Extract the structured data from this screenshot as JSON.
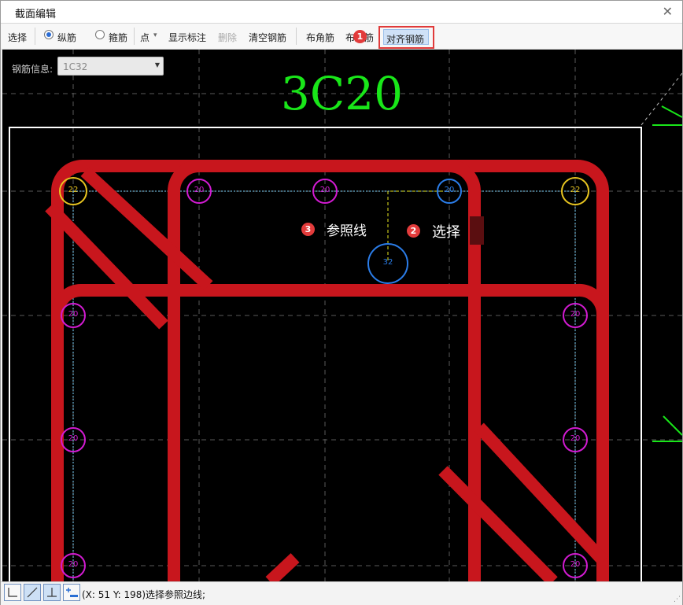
{
  "window": {
    "title": "截面编辑",
    "close_glyph": "✕"
  },
  "toolbar": {
    "select": "选择",
    "longitudinal": "纵筋",
    "stirrup": "箍筋",
    "point": "点",
    "point_arrow": "▾",
    "show_label": "显示标注",
    "delete": "删除",
    "clear_bars": "清空钢筋",
    "corner_bars": "布角筋",
    "edge_bars": "布边筋",
    "align_bars": "对齐钢筋"
  },
  "badges": {
    "b1": "1",
    "b2": "2",
    "b3": "3"
  },
  "canvas": {
    "rebar_info_label": "钢筋信息:",
    "rebar_info_value": "1C32",
    "top_label": "3C20",
    "callout_reference_line": "参照线",
    "callout_select": "选择",
    "bars": {
      "corner_tl": "22",
      "top_1": "20",
      "top_2": "20",
      "top_3": "20",
      "corner_tr": "22",
      "selected": "32",
      "left_1": "20",
      "left_2": "20",
      "left_3": "20",
      "right_1": "20",
      "right_2": "20",
      "right_3": "20"
    }
  },
  "statusbar": {
    "text": "(X: 51 Y: 198)选择参照边线;",
    "grip": "⋰"
  },
  "colors": {
    "stirrup_red": "#c8161d",
    "bar_magenta": "#d21bd2",
    "bar_yellow": "#e8c520",
    "bar_blue": "#2b7de9",
    "label_green": "#19e619",
    "highlight_red": "#e03a3a"
  }
}
